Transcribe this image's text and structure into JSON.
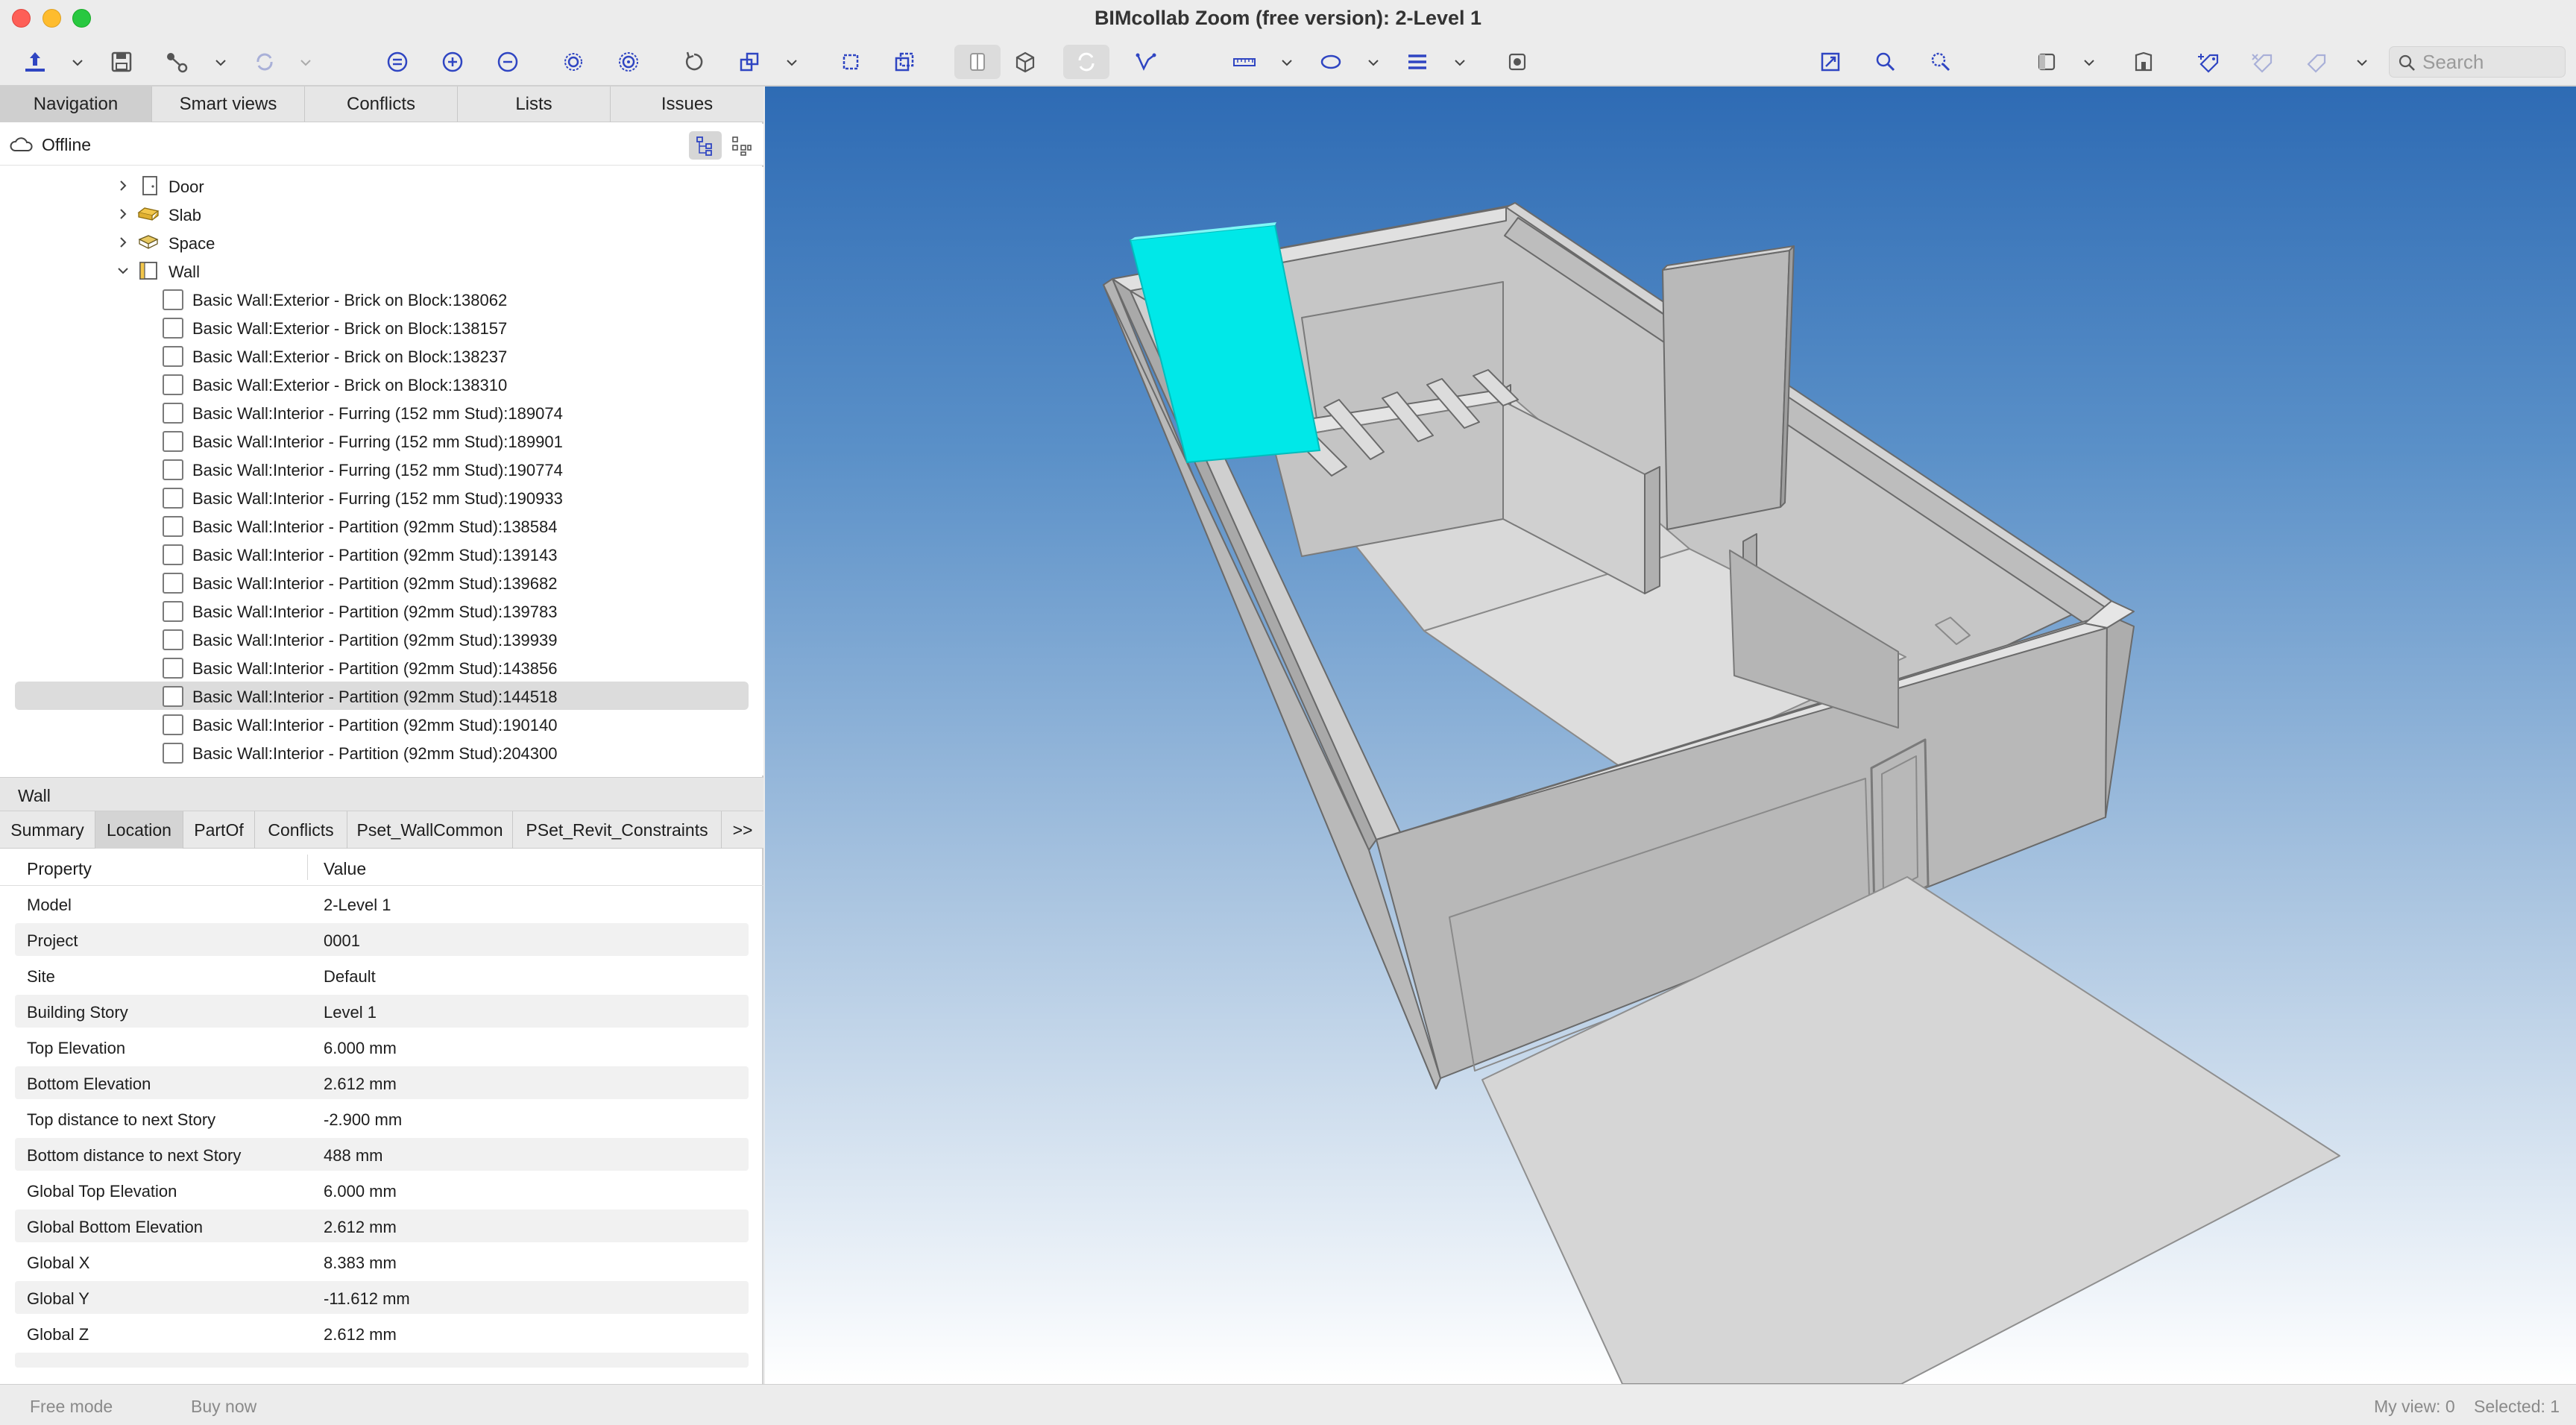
{
  "window": {
    "title": "BIMcollab Zoom (free version): 2-Level 1"
  },
  "toolbar": {
    "search_placeholder": "Search",
    "icons": [
      "open-icon",
      "save-icon",
      "connect-icon",
      "sync-icon",
      "isolate-icon",
      "add-icon",
      "remove-icon",
      "focus-icon",
      "focus-all-icon",
      "reset-icon",
      "views-icon",
      "box-icon",
      "box-multi-icon",
      "section-icon",
      "cube-icon",
      "reload-icon",
      "path-icon",
      "measure-icon",
      "ellipse-icon",
      "layers-icon",
      "snapshot-icon",
      "fit-icon",
      "zoom-icon",
      "zoom-selection-icon",
      "panel-icon",
      "building-icon",
      "tag-add-icon",
      "tag-remove-icon",
      "tag-icon",
      "search-icon"
    ]
  },
  "left_tabs": [
    "Navigation",
    "Smart views",
    "Conflicts",
    "Lists",
    "Issues"
  ],
  "connection_status": "Offline",
  "tree": {
    "categories": [
      {
        "label": "Door",
        "expanded": false,
        "icon": "door-icon"
      },
      {
        "label": "Slab",
        "expanded": false,
        "icon": "slab-icon"
      },
      {
        "label": "Space",
        "expanded": false,
        "icon": "space-icon"
      },
      {
        "label": "Wall",
        "expanded": true,
        "icon": "wall-icon"
      }
    ],
    "walls": [
      "Basic Wall:Exterior - Brick on Block:138062",
      "Basic Wall:Exterior - Brick on Block:138157",
      "Basic Wall:Exterior - Brick on Block:138237",
      "Basic Wall:Exterior - Brick on Block:138310",
      "Basic Wall:Interior - Furring (152 mm Stud):189074",
      "Basic Wall:Interior - Furring (152 mm Stud):189901",
      "Basic Wall:Interior - Furring (152 mm Stud):190774",
      "Basic Wall:Interior - Furring (152 mm Stud):190933",
      "Basic Wall:Interior - Partition (92mm Stud):138584",
      "Basic Wall:Interior - Partition (92mm Stud):139143",
      "Basic Wall:Interior - Partition (92mm Stud):139682",
      "Basic Wall:Interior - Partition (92mm Stud):139783",
      "Basic Wall:Interior - Partition (92mm Stud):139939",
      "Basic Wall:Interior - Partition (92mm Stud):143856",
      "Basic Wall:Interior - Partition (92mm Stud):144518",
      "Basic Wall:Interior - Partition (92mm Stud):190140",
      "Basic Wall:Interior - Partition (92mm Stud):204300"
    ],
    "selected_wall": "Basic Wall:Interior - Partition (92mm Stud):144518"
  },
  "properties": {
    "header": "Wall",
    "tabs": [
      "Summary",
      "Location",
      "PartOf",
      "Conflicts",
      "Pset_WallCommon",
      "PSet_Revit_Constraints",
      ">>"
    ],
    "selected_tab": "Location",
    "columns": [
      "Property",
      "Value"
    ],
    "rows": [
      {
        "key": "Model",
        "value": "2-Level 1"
      },
      {
        "key": "Project",
        "value": "0001"
      },
      {
        "key": "Site",
        "value": "Default"
      },
      {
        "key": "Building Story",
        "value": "Level 1"
      },
      {
        "key": "Top Elevation",
        "value": "6.000 mm"
      },
      {
        "key": "Bottom Elevation",
        "value": "2.612 mm"
      },
      {
        "key": "Top distance to next Story",
        "value": "-2.900 mm"
      },
      {
        "key": "Bottom distance to next Story",
        "value": "488 mm"
      },
      {
        "key": "Global Top Elevation",
        "value": "6.000 mm"
      },
      {
        "key": "Global Bottom Elevation",
        "value": "2.612 mm"
      },
      {
        "key": "Global X",
        "value": "8.383 mm"
      },
      {
        "key": "Global Y",
        "value": "-11.612 mm"
      },
      {
        "key": "Global Z",
        "value": "2.612 mm"
      }
    ]
  },
  "status_bar": {
    "mode": "Free mode",
    "buy": "Buy now",
    "my_view": "My view: 0",
    "selected": "Selected: 1"
  },
  "colors": {
    "selection_highlight": "#00e8e8",
    "viewport_top": "#2e6bb4",
    "viewport_bottom": "#ffffff"
  }
}
